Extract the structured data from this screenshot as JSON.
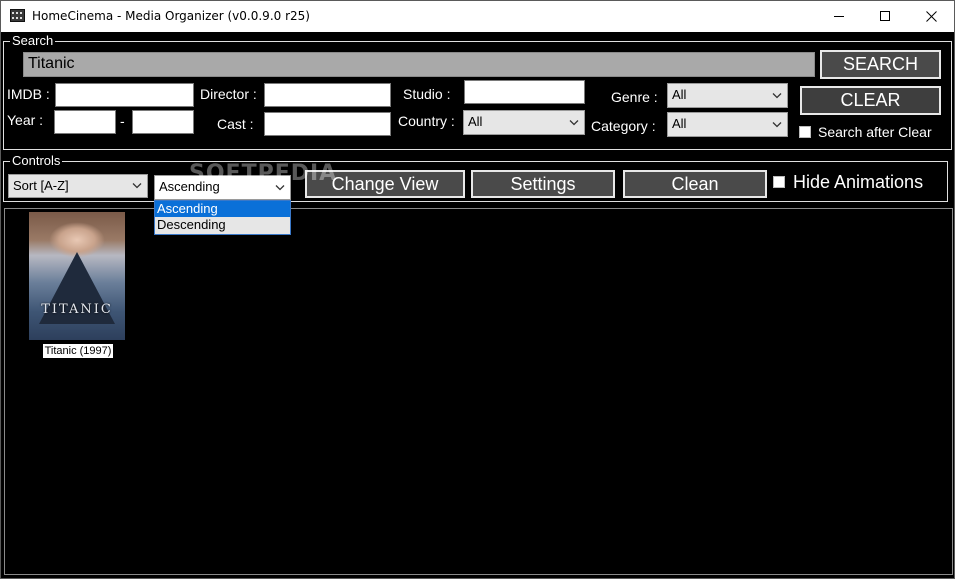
{
  "window": {
    "title": "HomeCinema - Media Organizer (v0.0.9.0 r25)"
  },
  "search_group": {
    "label": "Search",
    "query": "Titanic",
    "search_button": "SEARCH",
    "clear_button": "CLEAR",
    "search_after_clear_label": "Search after Clear",
    "imdb_label": "IMDB :",
    "imdb_value": "",
    "director_label": "Director :",
    "director_value": "",
    "studio_label": "Studio :",
    "studio_value": "",
    "year_label": "Year :",
    "year_from": "",
    "year_separator": "-",
    "year_to": "",
    "cast_label": "Cast :",
    "cast_value": "",
    "country_label": "Country :",
    "country_selected": "All",
    "genre_label": "Genre :",
    "genre_selected": "All",
    "category_label": "Category :",
    "category_selected": "All"
  },
  "controls_group": {
    "label": "Controls",
    "sort_selected": "Sort [A-Z]",
    "order_selected": "Ascending",
    "order_options": [
      "Ascending",
      "Descending"
    ],
    "change_view_button": "Change View",
    "settings_button": "Settings",
    "clean_button": "Clean",
    "hide_animations_label": "Hide Animations"
  },
  "media": {
    "items": [
      {
        "poster_title": "TITANIC",
        "label": "Titanic (1997)"
      }
    ]
  },
  "watermark": "SOFTPEDIA",
  "colors": {
    "background": "#000000",
    "button": "#4a4a4a",
    "selection": "#0a70d8"
  }
}
